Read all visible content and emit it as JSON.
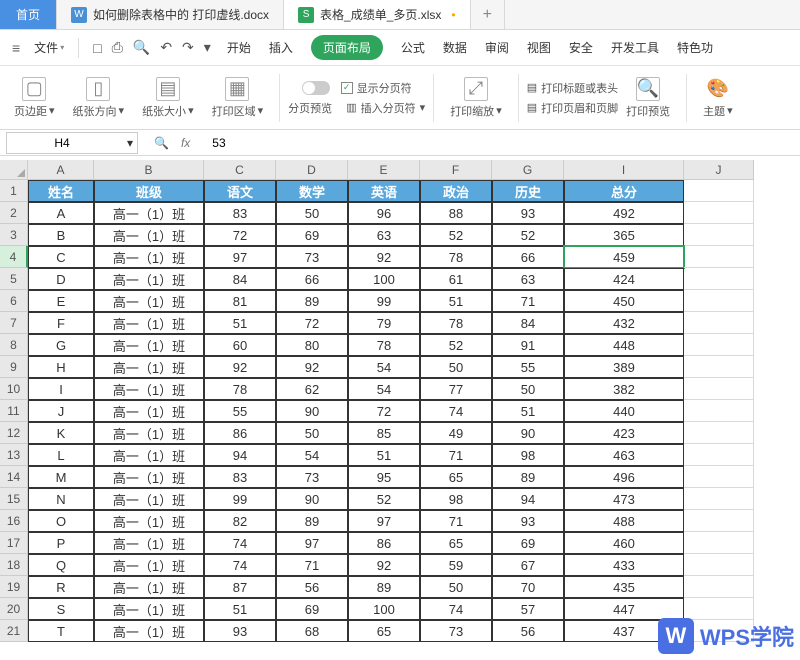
{
  "tabs": {
    "home": "首页",
    "doc": {
      "name": "如何删除表格中的 打印虚线.docx"
    },
    "xlsx": {
      "name": "表格_成绩单_多页.xlsx",
      "modified": "•"
    },
    "plus": "+"
  },
  "menubar": {
    "file": "文件",
    "menus": [
      "开始",
      "插入",
      "页面布局",
      "公式",
      "数据",
      "审阅",
      "视图",
      "安全",
      "开发工具",
      "特色功"
    ],
    "active_index": 2
  },
  "ribbon": {
    "margins": "页边距",
    "orientation": "纸张方向",
    "size": "纸张大小",
    "print_area": "打印区域",
    "page_preview": "分页预览",
    "show_breaks": "显示分页符",
    "insert_breaks": "插入分页符",
    "print_zoom": "打印缩放",
    "print_title": "打印标题或表头",
    "print_header": "打印页眉和页脚",
    "print_preview": "打印预览",
    "theme": "主题"
  },
  "cellref": "H4",
  "formula_value": "53",
  "columns": [
    {
      "letter": "A",
      "width": 66
    },
    {
      "letter": "B",
      "width": 110
    },
    {
      "letter": "C",
      "width": 72
    },
    {
      "letter": "D",
      "width": 72
    },
    {
      "letter": "E",
      "width": 72
    },
    {
      "letter": "F",
      "width": 72
    },
    {
      "letter": "G",
      "width": 72
    },
    {
      "letter": "I",
      "width": 120
    },
    {
      "letter": "J",
      "width": 70
    }
  ],
  "headers": [
    "姓名",
    "班级",
    "语文",
    "数学",
    "英语",
    "政治",
    "历史",
    "总分"
  ],
  "rows": [
    [
      "A",
      "高一（1）班",
      83,
      50,
      96,
      88,
      93,
      492
    ],
    [
      "B",
      "高一（1）班",
      72,
      69,
      63,
      52,
      52,
      365
    ],
    [
      "C",
      "高一（1）班",
      97,
      73,
      92,
      78,
      66,
      459
    ],
    [
      "D",
      "高一（1）班",
      84,
      66,
      100,
      61,
      63,
      424
    ],
    [
      "E",
      "高一（1）班",
      81,
      89,
      99,
      51,
      71,
      450
    ],
    [
      "F",
      "高一（1）班",
      51,
      72,
      79,
      78,
      84,
      432
    ],
    [
      "G",
      "高一（1）班",
      60,
      80,
      78,
      52,
      91,
      448
    ],
    [
      "H",
      "高一（1）班",
      92,
      92,
      54,
      50,
      55,
      389
    ],
    [
      "I",
      "高一（1）班",
      78,
      62,
      54,
      77,
      50,
      382
    ],
    [
      "J",
      "高一（1）班",
      55,
      90,
      72,
      74,
      51,
      440
    ],
    [
      "K",
      "高一（1）班",
      86,
      50,
      85,
      49,
      90,
      423
    ],
    [
      "L",
      "高一（1）班",
      94,
      54,
      51,
      71,
      98,
      463
    ],
    [
      "M",
      "高一（1）班",
      83,
      73,
      95,
      65,
      89,
      496
    ],
    [
      "N",
      "高一（1）班",
      99,
      90,
      52,
      98,
      94,
      473
    ],
    [
      "O",
      "高一（1）班",
      82,
      89,
      97,
      71,
      93,
      488
    ],
    [
      "P",
      "高一（1）班",
      74,
      97,
      86,
      65,
      69,
      460
    ],
    [
      "Q",
      "高一（1）班",
      74,
      71,
      92,
      59,
      67,
      433
    ],
    [
      "R",
      "高一（1）班",
      87,
      56,
      89,
      50,
      70,
      435
    ],
    [
      "S",
      "高一（1）班",
      51,
      69,
      100,
      74,
      57,
      447
    ],
    [
      "T",
      "高一（1）班",
      93,
      68,
      65,
      73,
      56,
      437
    ]
  ],
  "selected_row": 4,
  "watermark": "WPS学院"
}
